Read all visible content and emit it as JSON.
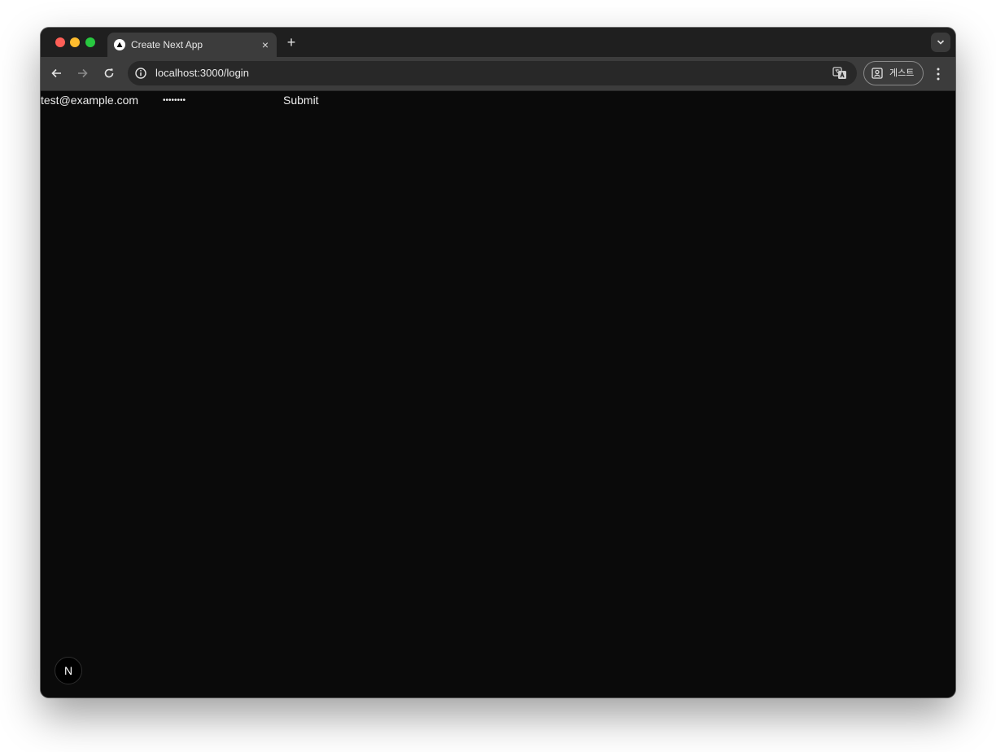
{
  "browser": {
    "tab": {
      "title": "Create Next App",
      "close_glyph": "×",
      "favicon": "vercel-triangle-icon"
    },
    "new_tab_glyph": "+",
    "address_bar": {
      "url": "localhost:3000/login"
    },
    "profile": {
      "label": "게스트"
    }
  },
  "page": {
    "email_text": "test@example.com",
    "password_text": "••••••••",
    "submit_label": "Submit",
    "dev_badge_label": "N"
  },
  "colors": {
    "page_background": "#0a0a0a",
    "text": "#ededed",
    "toolbar": "#3c3c3c",
    "tabstrip": "#1f1f1f"
  }
}
